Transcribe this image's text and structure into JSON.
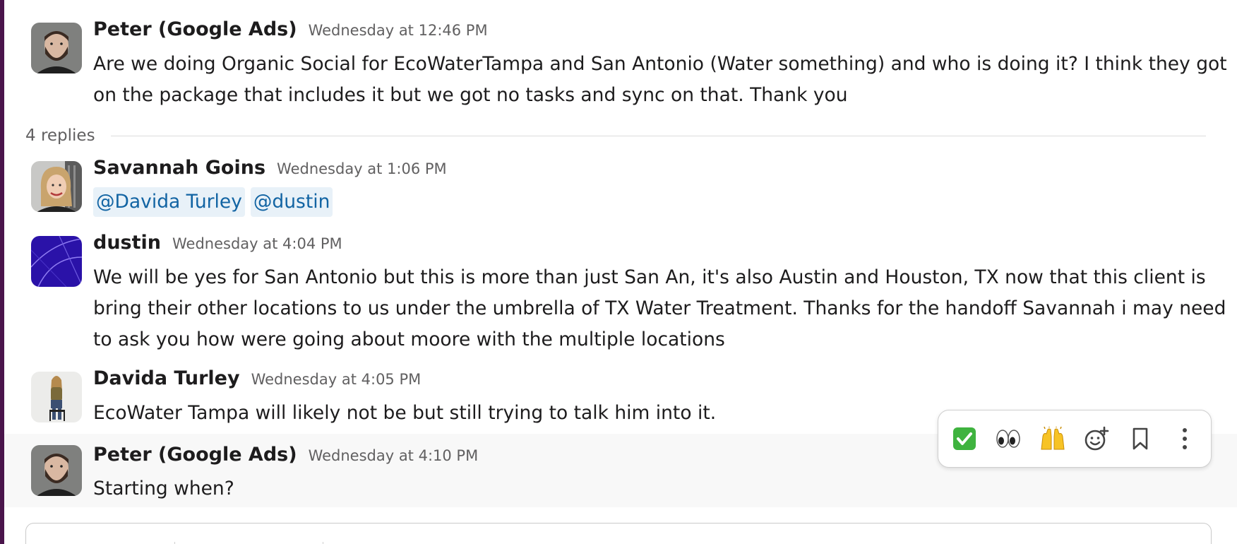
{
  "thread": {
    "parent": {
      "sender": "Peter (Google Ads)",
      "timestamp": "Wednesday at 12:46 PM",
      "text_line1": "Are we doing Organic Social for EcoWaterTampa and San Antonio (Water something) and who is doing it? I think they got",
      "text_line2": "on the package that includes it but we got no tasks and sync on that. Thank you"
    },
    "replies_label": "4 replies",
    "replies": [
      {
        "sender": "Savannah Goins",
        "timestamp": "Wednesday at 1:06 PM",
        "mentions": [
          "@Davida Turley",
          "@dustin"
        ]
      },
      {
        "sender": "dustin",
        "timestamp": "Wednesday at 4:04 PM",
        "text_line1": "We will be yes for San Antonio but this is more than just San An, it's also Austin and Houston, TX now that this client is",
        "text_line2": "bring their other locations to us under the umbrella of TX Water Treatment. Thanks for the handoff Savannah i may need",
        "text_line3": "to ask you how were going about moore with the multiple locations"
      },
      {
        "sender": "Davida Turley",
        "timestamp": "Wednesday at 4:05 PM",
        "text": "EcoWater Tampa will likely not be but still trying to talk him into it."
      },
      {
        "sender": "Peter (Google Ads)",
        "timestamp": "Wednesday at 4:10 PM",
        "text": "Starting when?"
      }
    ]
  },
  "hover_toolbar": {
    "reactions": [
      {
        "emoji": "✅",
        "icon": "white-check-mark-icon"
      },
      {
        "emoji": "👀",
        "icon": "eyes-icon"
      },
      {
        "emoji": "🙌",
        "icon": "raised-hands-icon"
      }
    ],
    "actions": [
      "add-reaction-icon",
      "bookmark-icon",
      "more-actions-icon"
    ]
  },
  "colors": {
    "accent_purple": "#4a154b",
    "mention_bg": "#e8f1f8",
    "mention_text": "#1264a3",
    "timestamp_gray": "#616061",
    "hover_bg": "#f8f8f8"
  }
}
